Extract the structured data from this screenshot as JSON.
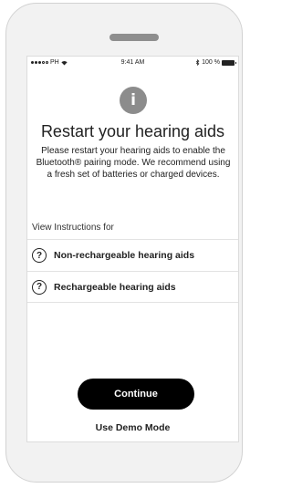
{
  "status_bar": {
    "carrier": "PH",
    "time": "9:41 AM",
    "battery": "100 %"
  },
  "header": {
    "icon": "info-icon",
    "title": "Restart your hearing aids",
    "description": "Please restart your hearing aids to enable the Bluetooth® pairing mode. We recommend using a fresh set of batteries or charged devices."
  },
  "instructions": {
    "label": "View Instructions for",
    "items": [
      {
        "label": "Non-rechargeable hearing aids",
        "icon": "question-icon"
      },
      {
        "label": "Rechargeable hearing aids",
        "icon": "question-icon"
      }
    ]
  },
  "actions": {
    "continue_label": "Continue",
    "demo_label": "Use Demo Mode"
  },
  "colors": {
    "primary_button": "#000000",
    "info_icon": "#8c8c8c"
  }
}
